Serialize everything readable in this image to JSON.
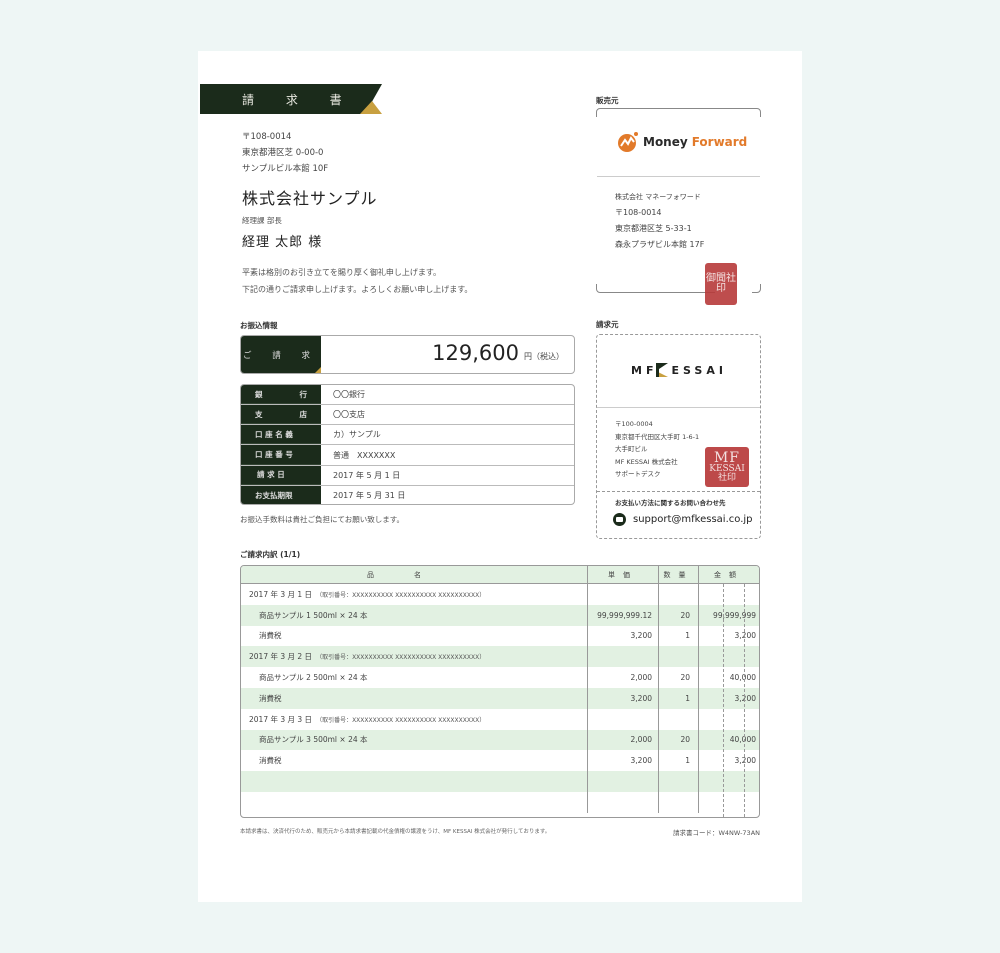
{
  "document": {
    "title": "請 求 書",
    "recipient": {
      "postal_code": "〒108-0014",
      "address_line1": "東京都港区芝 0-00-0",
      "address_line2": "サンプルビル本館 10F",
      "company": "株式会社サンプル",
      "department": "経理課 部長",
      "person": "経理 太郎 様"
    },
    "greeting": [
      "平素は格別のお引き立てを賜り厚く御礼申し上げます。",
      "下記の通りご請求申し上げます。よろしくお願い申し上げます。"
    ],
    "payment_info": {
      "section_label": "お振込情報",
      "amount_label": "ご 請 求",
      "amount": "129,600",
      "amount_unit": "円（税込）",
      "bank_rows": [
        {
          "key_left": "銀",
          "key_right": "行",
          "value": "〇〇銀行"
        },
        {
          "key_left": "支",
          "key_right": "店",
          "value": "〇〇支店"
        },
        {
          "key_left": "口 座 名 義",
          "key_right": "",
          "value": "カ）サンプル"
        },
        {
          "key_left": "口 座 番 号",
          "key_right": "",
          "value": "普通　XXXXXXX"
        },
        {
          "key_left": "請 求 日",
          "key_right": "",
          "value": "2017 年 5 月 1 日"
        },
        {
          "key_left": "お支払期限",
          "key_right": "",
          "value": "2017 年 5 月 31 日"
        }
      ],
      "fee_note": "お振込手数料は貴社ご負担にてお願い致します。"
    },
    "seller": {
      "section_label": "販売元",
      "logo_money": "Money",
      "logo_forward": "Forward",
      "company": "株式会社 マネーフォワード",
      "postal_code": "〒108-0014",
      "address_line1": "東京都港区芝 5-33-1",
      "address_line2": "森永プラザビル本館 17F",
      "seal_text": "御聞社印"
    },
    "biller": {
      "section_label": "請求元",
      "logo_left": "MF",
      "logo_right": "ESSAI",
      "address_lines": [
        "〒100-0004",
        "東京都千代田区大手町 1-6-1",
        "大手町ビル",
        "MF KESSAI 株式会社",
        "サポートデスク"
      ],
      "seal_mf": "MF",
      "seal_kessai": "KESSAI",
      "seal_sub": "社印",
      "contact_label": "お支払い方法に関するお問い合わせ先",
      "contact_email": "support@mfkessai.co.jp"
    },
    "details": {
      "section_label": "ご請求内訳 (1/1)",
      "headers": {
        "name": "品名",
        "price": "単価",
        "qty": "数量",
        "amount": "金額"
      },
      "rows": [
        {
          "type": "date",
          "name": "2017 年 3 月 1 日",
          "ref": "（取引番号：XXXXXXXXXX XXXXXXXXXX XXXXXXXXXX）",
          "price": "",
          "qty": "",
          "amount": ""
        },
        {
          "type": "item",
          "name": "商品サンプル 1  500ml × 24 本",
          "ref": "",
          "price": "99,999,999.12",
          "qty": "20",
          "amount": "99,999,999"
        },
        {
          "type": "item",
          "name": "消費税",
          "ref": "",
          "price": "3,200",
          "qty": "1",
          "amount": "3,200"
        },
        {
          "type": "date",
          "name": "2017 年 3 月 2 日",
          "ref": "（取引番号：XXXXXXXXXX XXXXXXXXXX XXXXXXXXXX）",
          "price": "",
          "qty": "",
          "amount": ""
        },
        {
          "type": "item",
          "name": "商品サンプル 2  500ml × 24 本",
          "ref": "",
          "price": "2,000",
          "qty": "20",
          "amount": "40,000"
        },
        {
          "type": "item",
          "name": "消費税",
          "ref": "",
          "price": "3,200",
          "qty": "1",
          "amount": "3,200"
        },
        {
          "type": "date",
          "name": "2017 年 3 月 3 日",
          "ref": "（取引番号：XXXXXXXXXX XXXXXXXXXX XXXXXXXXXX）",
          "price": "",
          "qty": "",
          "amount": ""
        },
        {
          "type": "item",
          "name": "商品サンプル 3  500ml × 24 本",
          "ref": "",
          "price": "2,000",
          "qty": "20",
          "amount": "40,000"
        },
        {
          "type": "item",
          "name": "消費税",
          "ref": "",
          "price": "3,200",
          "qty": "1",
          "amount": "3,200"
        },
        {
          "type": "empty",
          "name": "",
          "ref": "",
          "price": "",
          "qty": "",
          "amount": ""
        },
        {
          "type": "empty",
          "name": "",
          "ref": "",
          "price": "",
          "qty": "",
          "amount": ""
        }
      ]
    },
    "footer_note": "本請求書は、決済代行のため、販売元から本請求書記載の代金債権の譲渡をうけ、MF KESSAI 株式会社が発行しております。",
    "invoice_code": "請求書コード：W4NW-73AN"
  },
  "colors": {
    "background": "#eef6f5",
    "dark_green": "#1b2b1b",
    "gold": "#c8a040",
    "row_green": "#e2f1e2",
    "mf_orange": "#e27a2a",
    "seal_red": "#b83a3a"
  }
}
